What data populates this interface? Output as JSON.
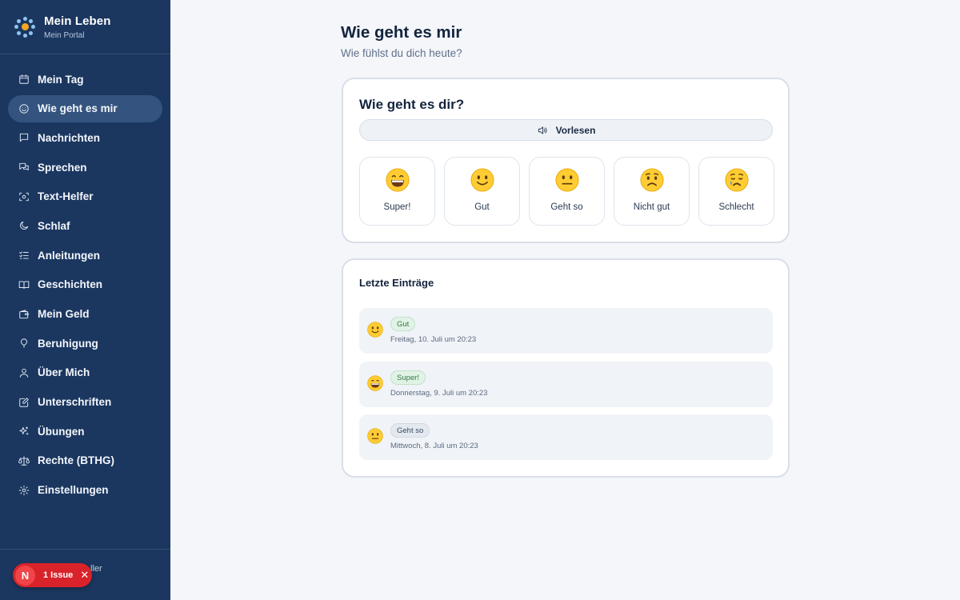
{
  "sidebar": {
    "brand_title": "Mein Leben",
    "brand_subtitle": "Mein Portal",
    "items": [
      {
        "label": "Mein Tag",
        "icon": "calendar-icon",
        "active": false
      },
      {
        "label": "Wie geht es mir",
        "icon": "smiley-icon",
        "active": true
      },
      {
        "label": "Nachrichten",
        "icon": "message-icon",
        "active": false
      },
      {
        "label": "Sprechen",
        "icon": "chat-icon",
        "active": false
      },
      {
        "label": "Text-Helfer",
        "icon": "scan-text-icon",
        "active": false
      },
      {
        "label": "Schlaf",
        "icon": "moon-icon",
        "active": false
      },
      {
        "label": "Anleitungen",
        "icon": "checklist-icon",
        "active": false
      },
      {
        "label": "Geschichten",
        "icon": "book-icon",
        "active": false
      },
      {
        "label": "Mein Geld",
        "icon": "wallet-icon",
        "active": false
      },
      {
        "label": "Beruhigung",
        "icon": "balloon-icon",
        "active": false
      },
      {
        "label": "Über Mich",
        "icon": "user-icon",
        "active": false
      },
      {
        "label": "Unterschriften",
        "icon": "signature-icon",
        "active": false
      },
      {
        "label": "Übungen",
        "icon": "sparkles-icon",
        "active": false
      },
      {
        "label": "Rechte (BTHG)",
        "icon": "scale-icon",
        "active": false
      },
      {
        "label": "Einstellungen",
        "icon": "gear-icon",
        "active": false
      }
    ],
    "footer_text": "ller",
    "issue": {
      "letter": "N",
      "label": "1 Issue",
      "close": "✕"
    }
  },
  "page": {
    "title": "Wie geht es mir",
    "subtitle": "Wie fühlst du dich heute?"
  },
  "mood_card": {
    "title": "Wie geht es dir?",
    "read_aloud_label": "Vorlesen",
    "options": [
      {
        "label": "Super!",
        "emoji": "grinning-face"
      },
      {
        "label": "Gut",
        "emoji": "slightly-smiling-face"
      },
      {
        "label": "Geht so",
        "emoji": "neutral-face"
      },
      {
        "label": "Nicht gut",
        "emoji": "worried-face"
      },
      {
        "label": "Schlecht",
        "emoji": "crying-face"
      }
    ]
  },
  "entries_card": {
    "title": "Letzte Einträge",
    "entries": [
      {
        "tag": "Gut",
        "date": "Freitag, 10. Juli um 20:23",
        "emoji": "slightly-smiling-face",
        "tag_style": "green"
      },
      {
        "tag": "Super!",
        "date": "Donnerstag, 9. Juli um 20:23",
        "emoji": "grinning-face",
        "tag_style": "green"
      },
      {
        "tag": "Geht so",
        "date": "Mittwoch, 8. Juli um 20:23",
        "emoji": "neutral-face",
        "tag_style": "gray"
      }
    ]
  },
  "colors": {
    "sidebar_bg": "#1b3760",
    "sidebar_active": "#34547f",
    "accent_orange": "#f5a623",
    "issue_red": "#d8232a"
  }
}
